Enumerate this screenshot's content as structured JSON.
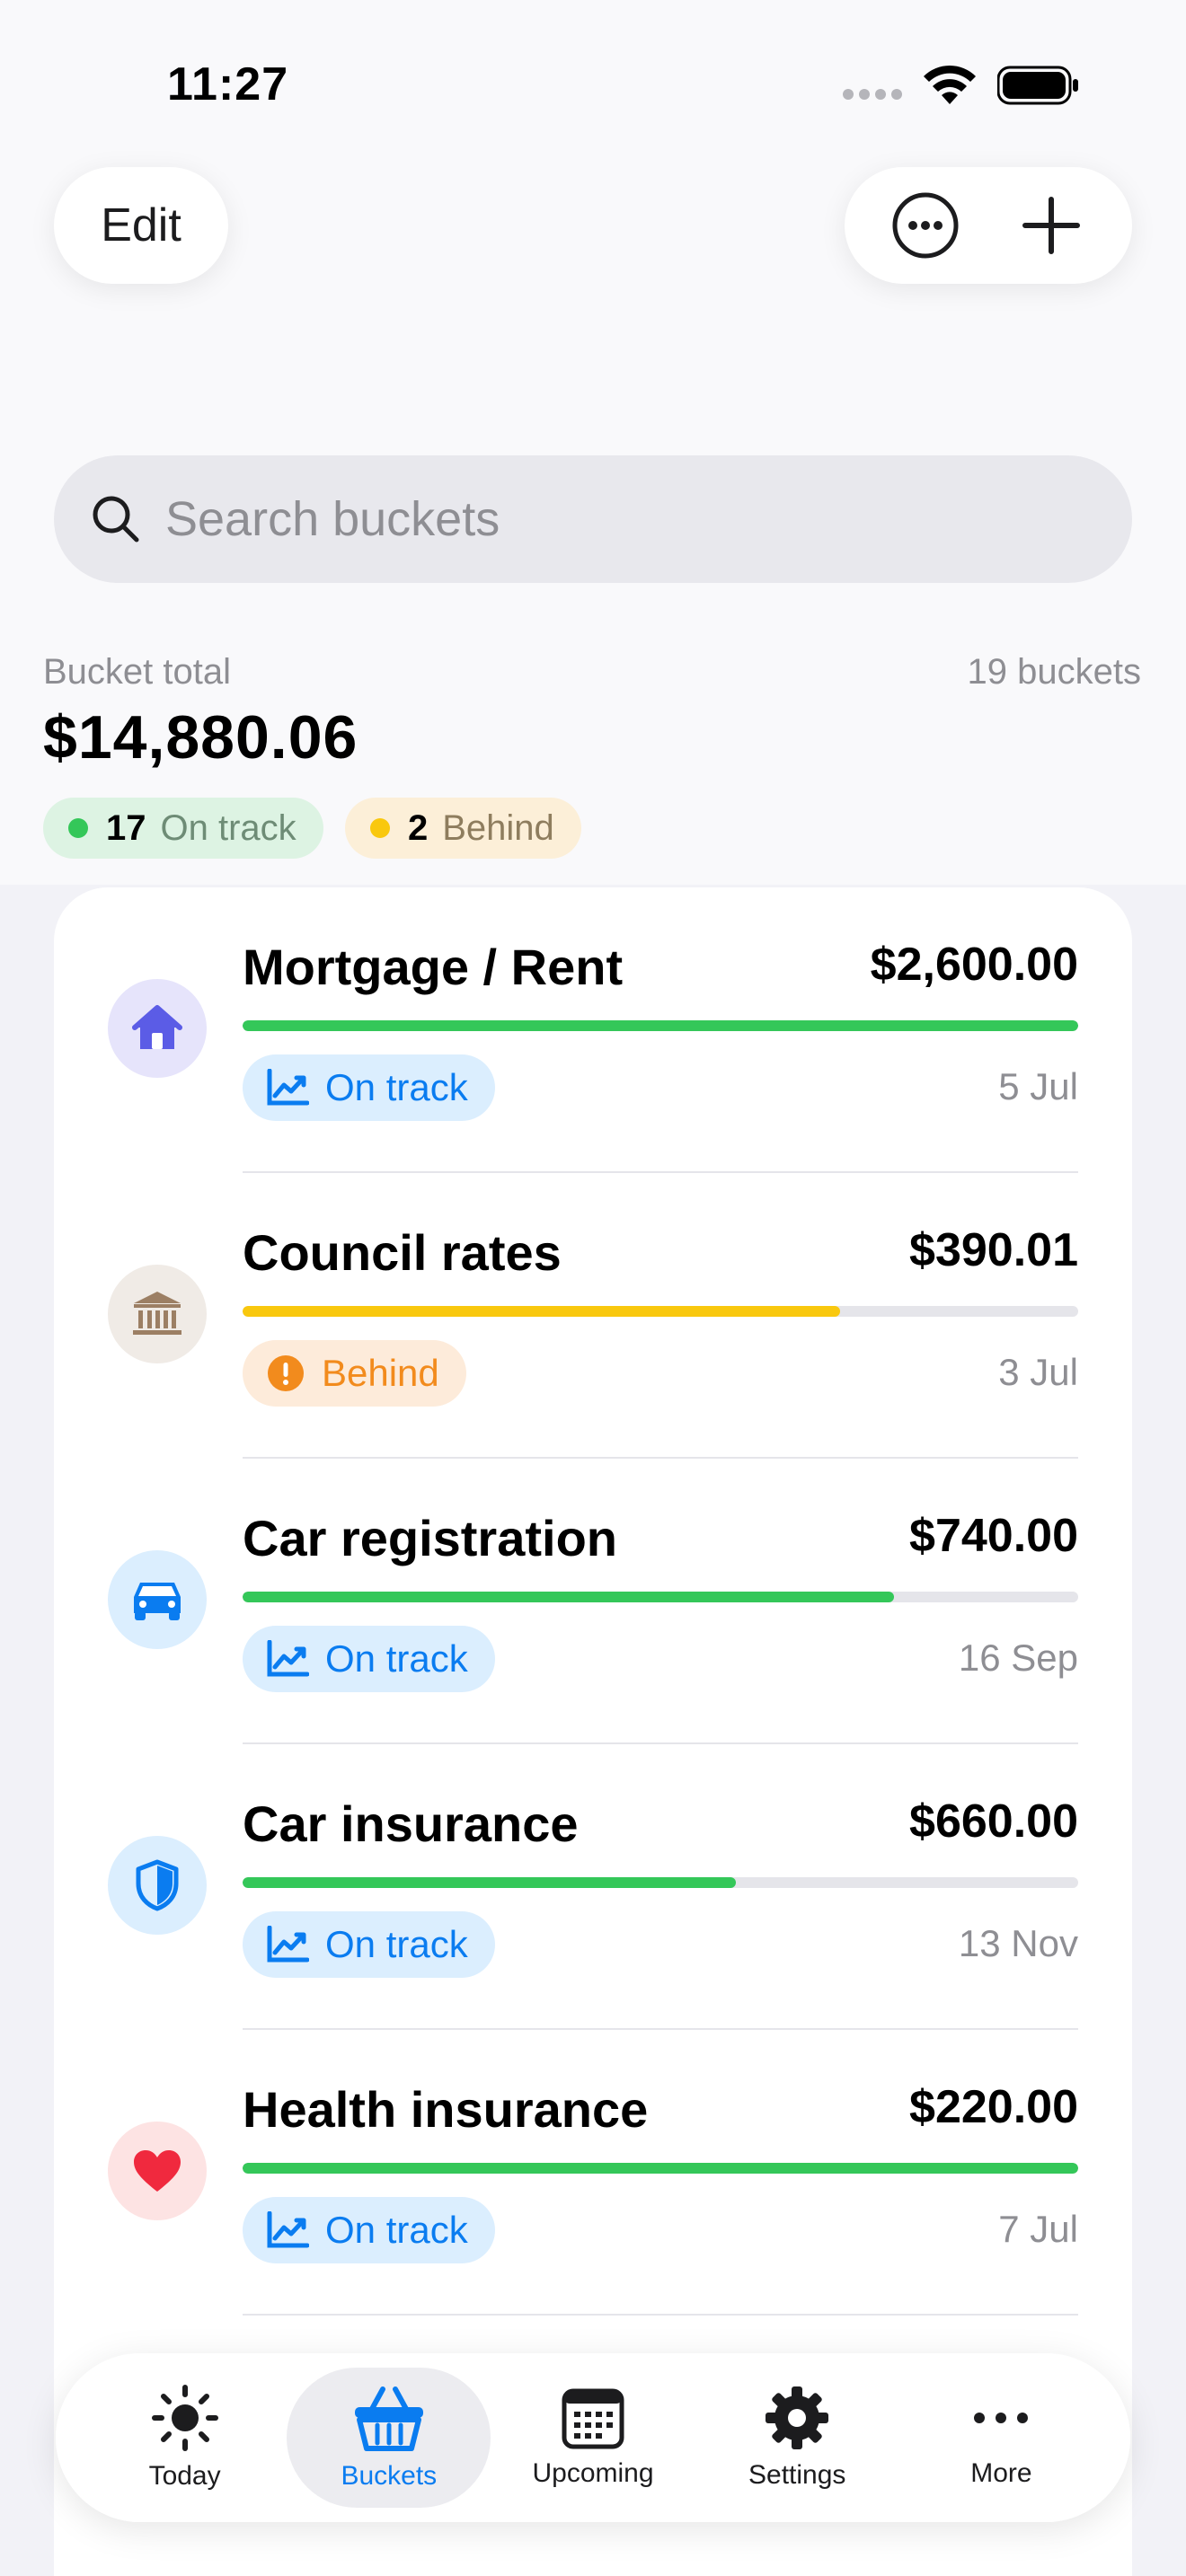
{
  "status": {
    "time": "11:27"
  },
  "header": {
    "edit_label": "Edit"
  },
  "search": {
    "placeholder": "Search buckets"
  },
  "summary": {
    "total_label": "Bucket total",
    "total_amount": "$14,880.06",
    "bucket_count": "19 buckets",
    "on_track_count": "17",
    "on_track_label": "On track",
    "behind_count": "2",
    "behind_label": "Behind"
  },
  "buckets": [
    {
      "name": "Mortgage / Rent",
      "amount": "$2,600.00",
      "progress": 1.0,
      "status": "On track",
      "date": "5 Jul",
      "icon": "house-icon"
    },
    {
      "name": "Council rates",
      "amount": "$390.01",
      "progress": 0.715,
      "status": "Behind",
      "date": "3 Jul",
      "icon": "bank-icon"
    },
    {
      "name": "Car registration",
      "amount": "$740.00",
      "progress": 0.78,
      "status": "On track",
      "date": "16 Sep",
      "icon": "car-icon"
    },
    {
      "name": "Car insurance",
      "amount": "$660.00",
      "progress": 0.59,
      "status": "On track",
      "date": "13 Nov",
      "icon": "shield-icon"
    },
    {
      "name": "Health insurance",
      "amount": "$220.00",
      "progress": 1.0,
      "status": "On track",
      "date": "7 Jul",
      "icon": "heart-icon"
    }
  ],
  "tabs": [
    {
      "label": "Today",
      "icon": "sun-icon"
    },
    {
      "label": "Buckets",
      "icon": "basket-icon"
    },
    {
      "label": "Upcoming",
      "icon": "calendar-icon"
    },
    {
      "label": "Settings",
      "icon": "gear-icon"
    },
    {
      "label": "More",
      "icon": "ellipsis-icon"
    }
  ],
  "colors": {
    "accent": "#0a7cf0",
    "on_track": "#34c759",
    "behind": "#f9c80e",
    "behind_text": "#f28b1d"
  }
}
